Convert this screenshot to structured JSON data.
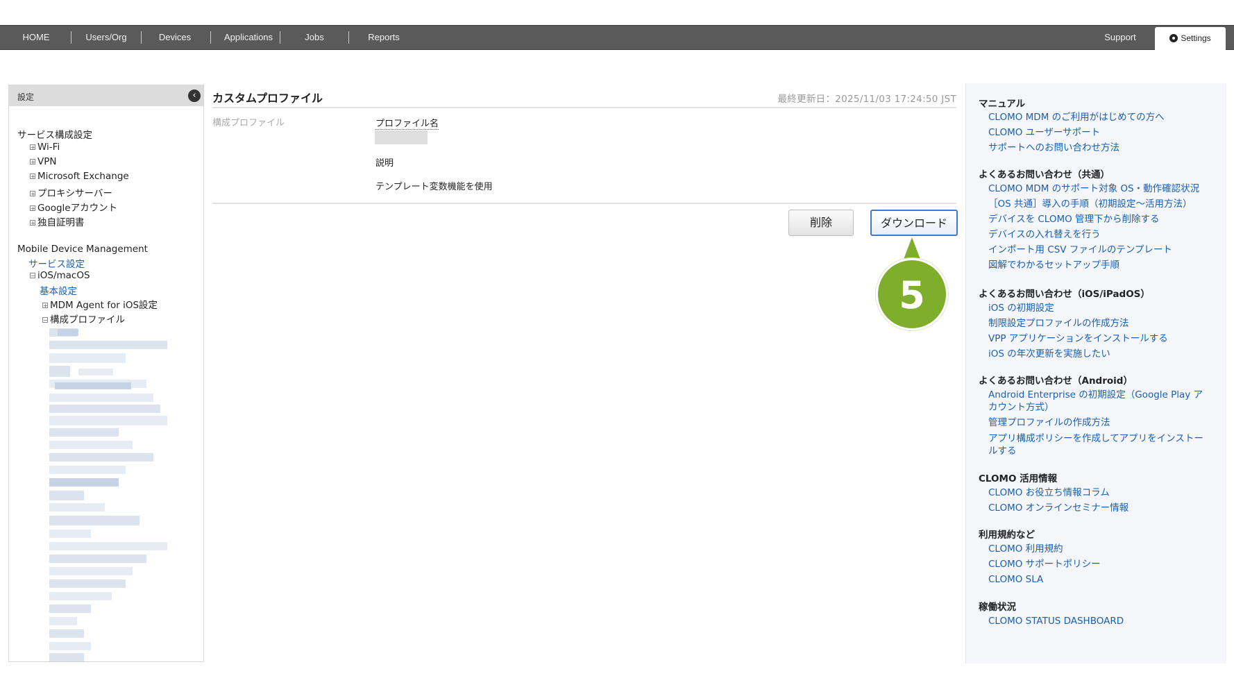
{
  "nav": {
    "items": [
      "HOME",
      "Users/Org",
      "Devices",
      "Applications",
      "Jobs",
      "Reports"
    ],
    "support": "Support",
    "settings": "Settings"
  },
  "sidebar": {
    "title": "設定",
    "service_header": "サービス構成設定",
    "service_items": [
      "Wi-Fi",
      "VPN",
      "Microsoft Exchange",
      "プロキシサーバー",
      "Googleアカウント",
      "独自証明書"
    ],
    "mdm_header": "Mobile Device Management",
    "service_settings": "サービス設定",
    "ios_macos": "iOS/macOS",
    "basic_settings": "基本設定",
    "mdm_agent": "MDM Agent for iOS設定",
    "config_profiles": "構成プロファイル"
  },
  "main": {
    "title": "カスタムプロファイル",
    "last_updated": "最終更新日：2025/11/03 17:24:50 JST",
    "section_label": "構成プロファイル",
    "profile_name_label": "プロファイル名",
    "description_label": "説明",
    "template_label": "テンプレート変数機能を使用",
    "delete_button": "削除",
    "download_button": "ダウンロード"
  },
  "step_marker": "5",
  "help": {
    "manual_head": "マニュアル",
    "manual_links": [
      "CLOMO MDM のご利用がはじめての方へ",
      "CLOMO ユーザーサポート",
      "サポートへのお問い合わせ方法"
    ],
    "faq_common_head": "よくあるお問い合わせ（共通）",
    "faq_common_links": [
      "CLOMO MDM のサポート対象 OS・動作確認状況",
      "［OS 共通］導入の手順（初期設定～活用方法）",
      "デバイスを CLOMO 管理下から削除する",
      "デバイスの入れ替えを行う",
      "インポート用 CSV ファイルのテンプレート",
      "図解でわかるセットアップ手順"
    ],
    "faq_ios_head": "よくあるお問い合わせ（iOS/iPadOS）",
    "faq_ios_links": [
      "iOS の初期設定",
      "制限設定プロファイルの作成方法",
      "VPP アプリケーションをインストールする",
      "iOS の年次更新を実施したい"
    ],
    "faq_android_head": "よくあるお問い合わせ（Android）",
    "faq_android_links": [
      "Android Enterprise の初期設定（Google Play ア",
      "カウント方式）",
      "管理プロファイルの作成方法",
      "アプリ構成ポリシーを作成してアプリをインストー",
      "ルする"
    ],
    "usage_head": "CLOMO 活用情報",
    "usage_links": [
      "CLOMO お役立ち情報コラム",
      "CLOMO オンラインセミナー情報"
    ],
    "terms_head": "利用規約など",
    "terms_links": [
      "CLOMO 利用規約",
      "CLOMO サポートポリシー",
      "CLOMO SLA"
    ],
    "status_head": "稼働状況",
    "status_links": [
      "CLOMO STATUS DASHBOARD"
    ]
  },
  "colors": {
    "nav_bg": "#5a5a5a",
    "link": "#1a5fb0",
    "step_marker": "#7fad2c",
    "download_border": "#3e78c8"
  }
}
